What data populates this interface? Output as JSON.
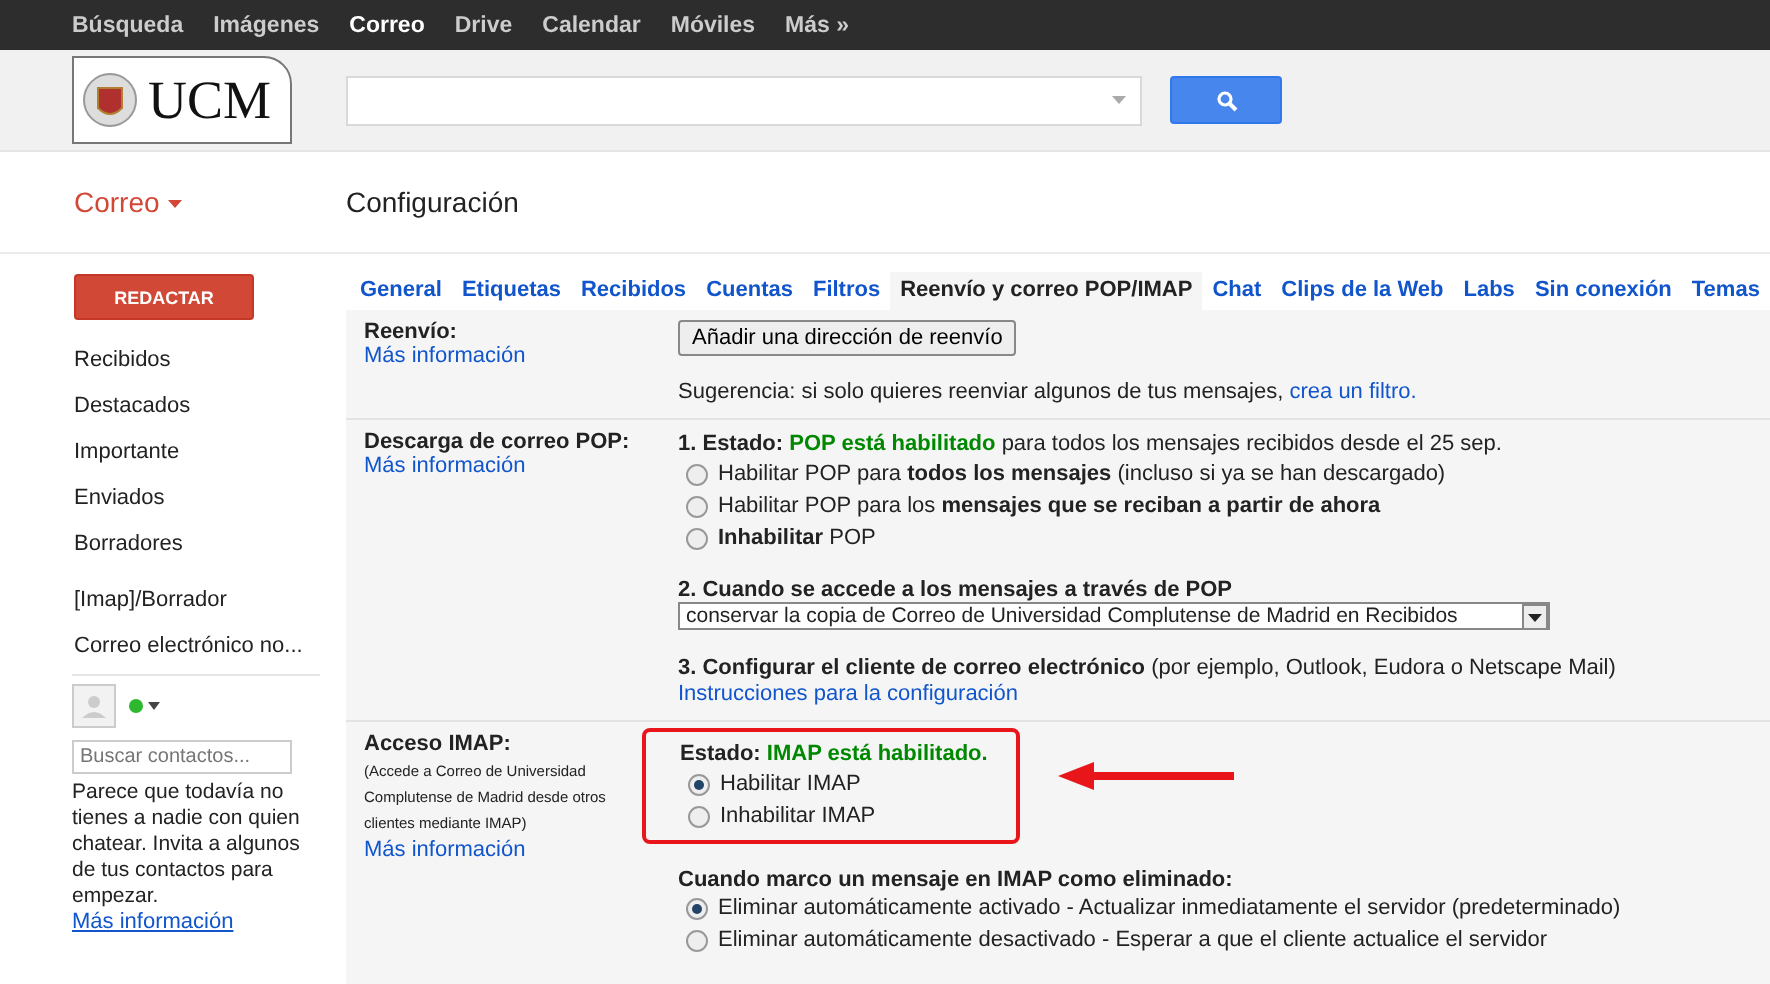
{
  "top_nav": [
    {
      "label": "Búsqueda",
      "selected": false
    },
    {
      "label": "Imágenes",
      "selected": false
    },
    {
      "label": "Correo",
      "selected": true
    },
    {
      "label": "Drive",
      "selected": false
    },
    {
      "label": "Calendar",
      "selected": false
    },
    {
      "label": "Móviles",
      "selected": false
    },
    {
      "label": "Más »",
      "selected": false
    }
  ],
  "logo": {
    "text": "UCM"
  },
  "app_title": "Correo",
  "page_title": "Configuración",
  "compose_button": "REDACTAR",
  "sidebar": {
    "items": [
      {
        "label": "Recibidos"
      },
      {
        "label": "Destacados"
      },
      {
        "label": "Importante"
      },
      {
        "label": "Enviados"
      },
      {
        "label": "Borradores"
      },
      {
        "label": "[Imap]/Borrador"
      },
      {
        "label": "Correo electrónico no..."
      }
    ]
  },
  "chat": {
    "search_placeholder": "Buscar contactos...",
    "message": "Parece que todavía no tienes a nadie con quien chatear. Invita a algunos de tus contactos para empezar.",
    "link": "Más información"
  },
  "tabs": [
    {
      "label": "General",
      "selected": false
    },
    {
      "label": "Etiquetas",
      "selected": false
    },
    {
      "label": "Recibidos",
      "selected": false
    },
    {
      "label": "Cuentas",
      "selected": false
    },
    {
      "label": "Filtros",
      "selected": false
    },
    {
      "label": "Reenvío y correo POP/IMAP",
      "selected": true
    },
    {
      "label": "Chat",
      "selected": false
    },
    {
      "label": "Clips de la Web",
      "selected": false
    },
    {
      "label": "Labs",
      "selected": false
    },
    {
      "label": "Sin conexión",
      "selected": false
    },
    {
      "label": "Temas",
      "selected": false
    }
  ],
  "forwarding": {
    "label": "Reenvío:",
    "link": "Más información",
    "button": "Añadir una dirección de reenvío",
    "hint": "Sugerencia: si solo quieres reenviar algunos de tus mensajes,",
    "hint_link": "crea un filtro."
  },
  "pop": {
    "label": "Descarga de correo POP:",
    "link": "Más información",
    "status": {
      "prefix": "1. Estado:",
      "value": "POP está habilitado",
      "suffix": "para todos los mensajes recibidos desde el 25 sep."
    },
    "options": [
      {
        "text": "Habilitar POP para **todos los mensajes** (incluso si ya se han descargado)",
        "selected": false
      },
      {
        "text": "Habilitar POP para los **mensajes que se reciban a partir de ahora**",
        "selected": false
      },
      {
        "text": "**Inhabilitar** POP",
        "selected": false
      }
    ],
    "when_heading": "2. Cuando se accede a los mensajes a través de POP",
    "when_value": "conservar la copia de Correo de Universidad Complutense de Madrid en Recibidos",
    "client_heading": "3. Configurar el cliente de correo electrónico",
    "client_note": "(por ejemplo, Outlook, Eudora o Netscape Mail)",
    "client_link": "Instrucciones para la configuración"
  },
  "imap": {
    "label": "Acceso IMAP:",
    "note": "(Accede a Correo de Universidad Complutense de Madrid desde otros clientes mediante IMAP)",
    "link": "Más información",
    "status": {
      "prefix": "Estado:",
      "value": "IMAP está habilitado."
    },
    "options": [
      {
        "text": "Habilitar IMAP",
        "selected": true
      },
      {
        "text": "Inhabilitar IMAP",
        "selected": false
      }
    ],
    "delete_heading": "Cuando marco un mensaje en IMAP como eliminado:",
    "delete_options": [
      {
        "text": "Eliminar automáticamente activado - Actualizar inmediatamente el servidor (predeterminado)",
        "selected": true
      },
      {
        "text": "Eliminar automáticamente desactivado - Esperar a que el cliente actualice el servidor",
        "selected": false
      }
    ]
  }
}
